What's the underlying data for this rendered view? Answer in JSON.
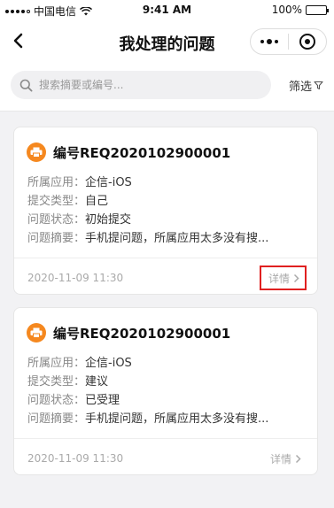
{
  "status_bar": {
    "carrier": "中国电信",
    "time": "9:41 AM",
    "battery_pct": "100%"
  },
  "nav": {
    "title": "我处理的问题"
  },
  "search": {
    "placeholder": "搜索摘要或编号..."
  },
  "filter": {
    "label": "筛选"
  },
  "cards": [
    {
      "id": "编号REQ2020102900001",
      "fields": [
        {
          "key": "所属应用：",
          "value": "企信-iOS"
        },
        {
          "key": "提交类型：",
          "value": "自己"
        },
        {
          "key": "问题状态：",
          "value": "初始提交"
        },
        {
          "key": "问题摘要：",
          "value": "手机提问题，所属应用太多没有搜..."
        }
      ],
      "date": "2020-11-09  11:30",
      "detail_label": "详情"
    },
    {
      "id": "编号REQ2020102900001",
      "fields": [
        {
          "key": "所属应用：",
          "value": "企信-iOS"
        },
        {
          "key": "提交类型：",
          "value": "建议"
        },
        {
          "key": "问题状态：",
          "value": "已受理"
        },
        {
          "key": "问题摘要：",
          "value": "手机提问题，所属应用太多没有搜..."
        }
      ],
      "date": "2020-11-09  11:30",
      "detail_label": "详情"
    }
  ],
  "icons": {
    "card_badge": "printer-icon",
    "badge_color": "#f5881f",
    "highlight_color": "#e02020"
  }
}
